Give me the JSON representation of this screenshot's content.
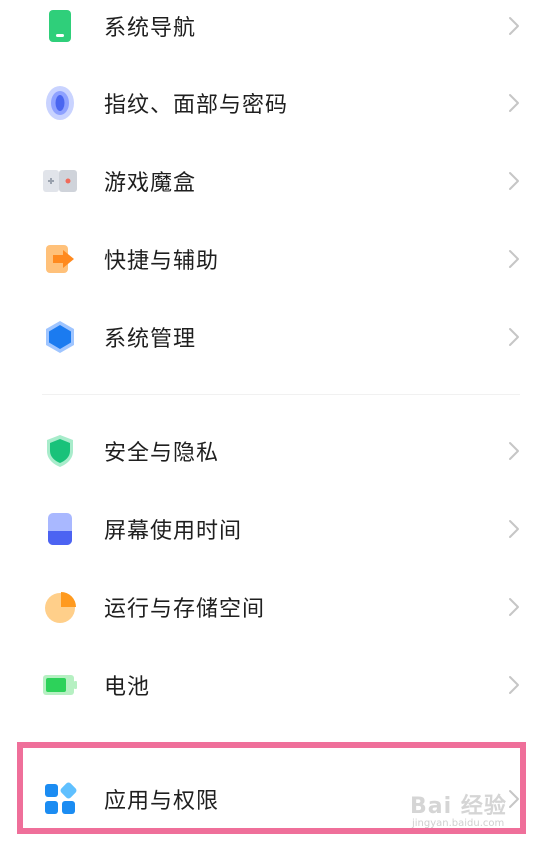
{
  "settings": {
    "items": [
      {
        "label": "系统导航",
        "icon": "navigation-icon"
      },
      {
        "label": "指纹、面部与密码",
        "icon": "fingerprint-icon"
      },
      {
        "label": "游戏魔盒",
        "icon": "gamebox-icon"
      },
      {
        "label": "快捷与辅助",
        "icon": "shortcut-icon"
      },
      {
        "label": "系统管理",
        "icon": "system-management-icon"
      },
      {
        "label": "安全与隐私",
        "icon": "shield-icon"
      },
      {
        "label": "屏幕使用时间",
        "icon": "hourglass-icon"
      },
      {
        "label": "运行与存储空间",
        "icon": "storage-pie-icon"
      },
      {
        "label": "电池",
        "icon": "battery-icon"
      },
      {
        "label": "应用与权限",
        "icon": "apps-icon"
      }
    ]
  },
  "watermark": {
    "logo": "Bai 经验",
    "sub": "jingyan.baidu.com"
  },
  "colors": {
    "highlight": "#ef6f9a",
    "chevron": "#c6c6c6"
  }
}
